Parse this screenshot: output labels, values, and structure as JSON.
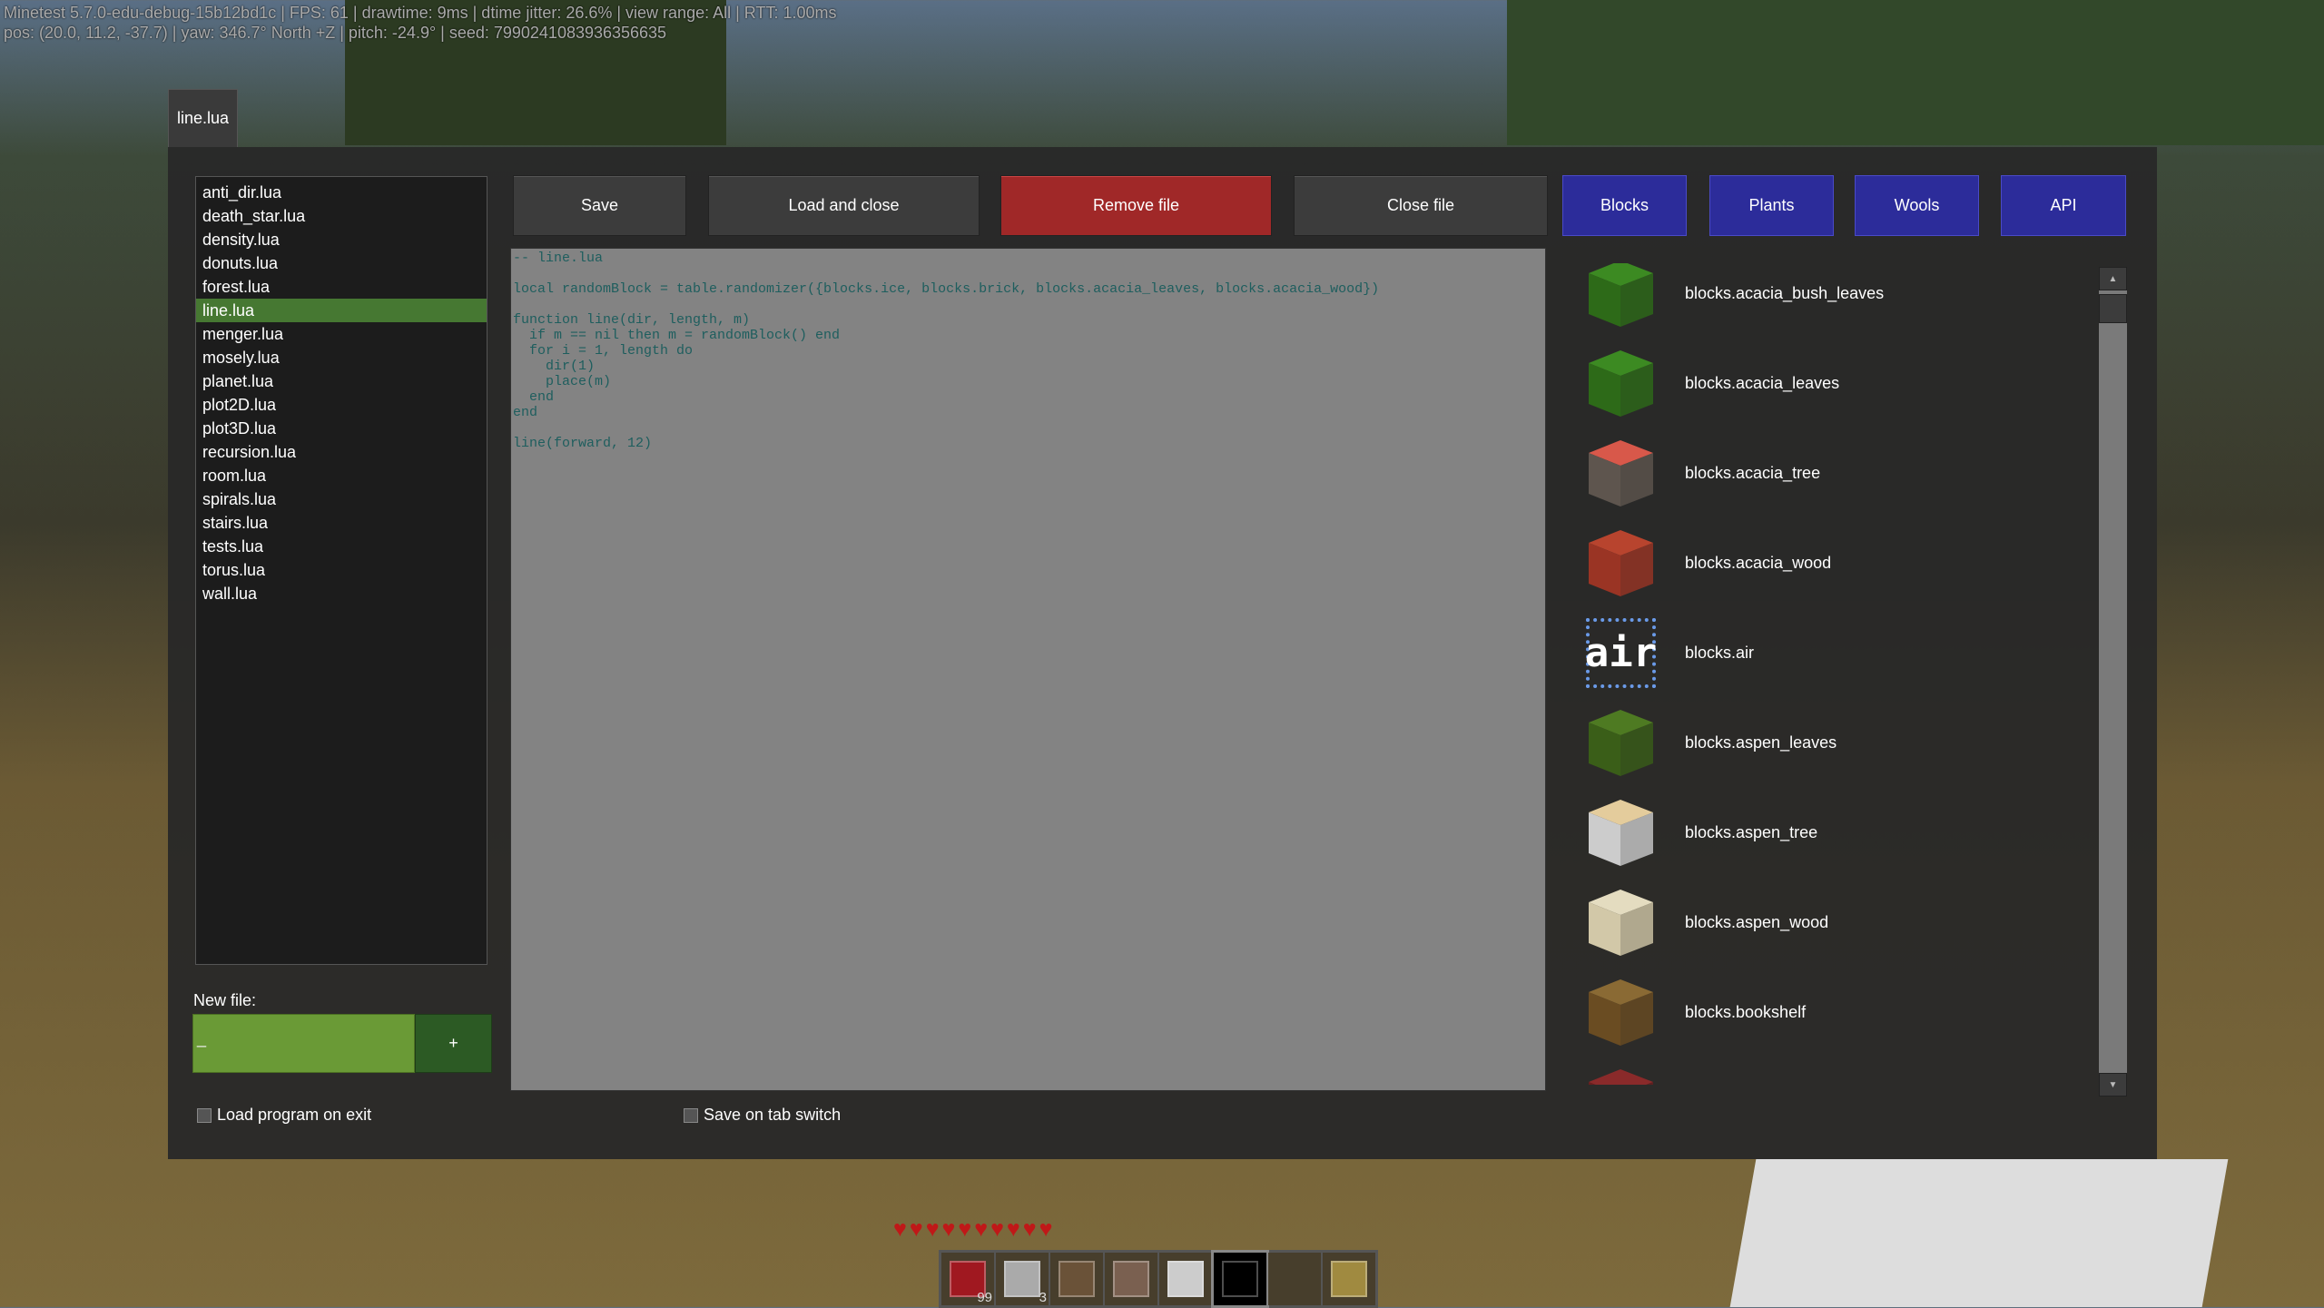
{
  "debug": {
    "line1": "Minetest 5.7.0-edu-debug-15b12bd1c | FPS: 61 | drawtime: 9ms | dtime jitter: 26.6% | view range: All | RTT: 1.00ms",
    "line2": "pos: (20.0, 11.2, -37.7) | yaw: 346.7° North +Z | pitch: -24.9° | seed: 7990241083936356635"
  },
  "tab": {
    "label": "line.lua"
  },
  "files": [
    "anti_dir.lua",
    "death_star.lua",
    "density.lua",
    "donuts.lua",
    "forest.lua",
    "line.lua",
    "menger.lua",
    "mosely.lua",
    "planet.lua",
    "plot2D.lua",
    "plot3D.lua",
    "recursion.lua",
    "room.lua",
    "spirals.lua",
    "stairs.lua",
    "tests.lua",
    "torus.lua",
    "wall.lua"
  ],
  "selected_file": "line.lua",
  "new_file": {
    "label": "New file:",
    "value": "_",
    "add": "+"
  },
  "checkboxes": {
    "load_on_exit": "Load program on exit",
    "save_on_switch": "Save on tab switch"
  },
  "buttons": {
    "save": "Save",
    "load_close": "Load and close",
    "remove": "Remove file",
    "close": "Close file",
    "blocks": "Blocks",
    "plants": "Plants",
    "wools": "Wools",
    "api": "API"
  },
  "code": "-- line.lua\n\nlocal randomBlock = table.randomizer({blocks.ice, blocks.brick, blocks.acacia_leaves, blocks.acacia_wood})\n\nfunction line(dir, length, m)\n  if m == nil then m = randomBlock() end\n  for i = 1, length do\n    dir(1)\n    place(m)\n  end\nend\n\nline(forward, 12)",
  "blocks": [
    {
      "name": "blocks.acacia_bush_leaves",
      "top": "#3c8a22",
      "side": "#2d6a18"
    },
    {
      "name": "blocks.acacia_leaves",
      "top": "#3c8a22",
      "side": "#2d6a18"
    },
    {
      "name": "blocks.acacia_tree",
      "top": "#d8584a",
      "side": "#5e554e"
    },
    {
      "name": "blocks.acacia_wood",
      "top": "#b8442e",
      "side": "#9a3424"
    },
    {
      "name": "blocks.air",
      "top": "",
      "side": ""
    },
    {
      "name": "blocks.aspen_leaves",
      "top": "#4e7a22",
      "side": "#3a5e18"
    },
    {
      "name": "blocks.aspen_tree",
      "top": "#e4cc9c",
      "side": "#cccccc"
    },
    {
      "name": "blocks.aspen_wood",
      "top": "#e4dcc0",
      "side": "#d2c8a8"
    },
    {
      "name": "blocks.bookshelf",
      "top": "#8a6a34",
      "side": "#6a4c22"
    },
    {
      "name": "",
      "top": "#8a2a2a",
      "side": "#6a1e1e"
    }
  ],
  "air_label": "air",
  "hotbar": [
    {
      "color": "#a01820",
      "count": "99"
    },
    {
      "color": "#aaaaaa",
      "count": "3"
    },
    {
      "color": "#6a5238",
      "count": ""
    },
    {
      "color": "#7a6050",
      "count": ""
    },
    {
      "color": "#cccccc",
      "count": ""
    },
    {
      "color": "#000000",
      "count": ""
    },
    {
      "color": "",
      "count": ""
    },
    {
      "color": "#a08a40",
      "count": ""
    }
  ],
  "hearts": 10
}
